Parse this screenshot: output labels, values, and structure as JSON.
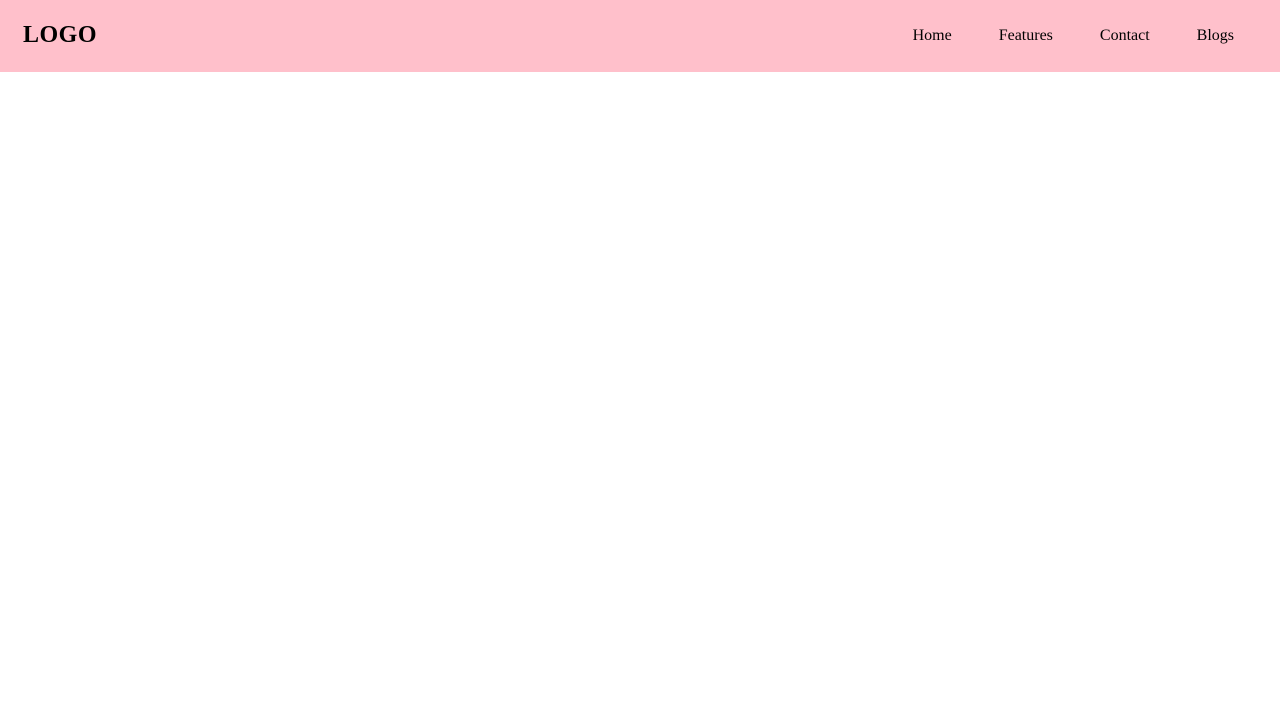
{
  "header": {
    "logo_text": "LOGO",
    "background_color": "#ffc0cb",
    "nav": [
      {
        "label": "Home"
      },
      {
        "label": "Features"
      },
      {
        "label": "Contact"
      },
      {
        "label": "Blogs"
      }
    ]
  }
}
